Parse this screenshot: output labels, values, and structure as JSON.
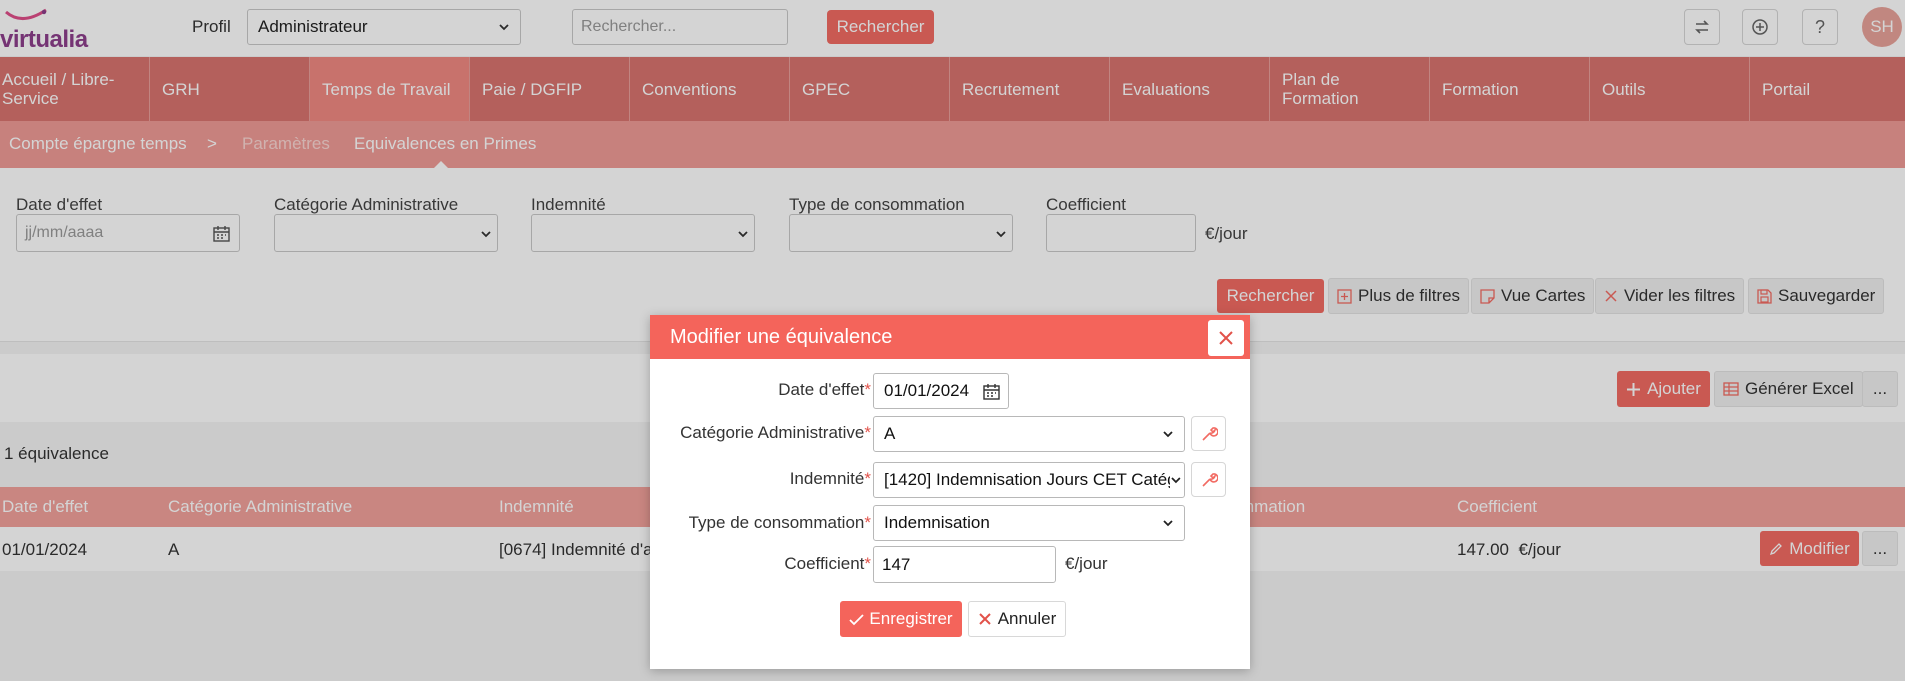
{
  "header": {
    "brand": "virtualia",
    "profil_label": "Profil",
    "profil_value": "Administrateur",
    "search_placeholder": "Rechercher...",
    "search_button": "Rechercher",
    "help_icon_glyph": "?",
    "avatar_initials": "SH",
    "icons": [
      "switch-icon",
      "plus-circle-icon",
      "help-icon"
    ]
  },
  "main_nav": [
    {
      "label": "Accueil / Libre-Service"
    },
    {
      "label": "GRH"
    },
    {
      "label": "Temps de Travail",
      "active": true
    },
    {
      "label": "Paie / DGFIP"
    },
    {
      "label": "Conventions"
    },
    {
      "label": "GPEC"
    },
    {
      "label": "Recrutement"
    },
    {
      "label": "Evaluations"
    },
    {
      "label": "Plan de Formation"
    },
    {
      "label": "Formation"
    },
    {
      "label": "Outils"
    },
    {
      "label": "Portail"
    }
  ],
  "sub_nav": {
    "item1": "Compte épargne temps",
    "separator": ">",
    "item2": "Paramètres",
    "item3": "Equivalences en Primes"
  },
  "filters": {
    "date_label": "Date d'effet",
    "date_placeholder": "jj/mm/aaaa",
    "categorie_label": "Catégorie Administrative",
    "indemnite_label": "Indemnité",
    "type_label": "Type de consommation",
    "coefficient_label": "Coefficient",
    "coefficient_unit": "€/jour",
    "buttons": {
      "rechercher": "Rechercher",
      "plus_filtres": "Plus de filtres",
      "vue_cartes": "Vue Cartes",
      "vider": "Vider les filtres",
      "sauvegarder": "Sauvegarder"
    }
  },
  "toolbar": {
    "ajouter": "Ajouter",
    "generer_excel": "Générer Excel",
    "more": "..."
  },
  "results": {
    "count": "1 équivalence",
    "columns": [
      "Date d'effet",
      "Catégorie Administrative",
      "Indemnité",
      "mmation",
      "Coefficient"
    ],
    "rows": [
      {
        "date": "01/01/2024",
        "categorie": "A",
        "indemnite": "[0674] Indemnité d'a",
        "coefficient": "147.00  €/jour",
        "modifier": "Modifier",
        "more": "..."
      }
    ]
  },
  "modal": {
    "title": "Modifier une équivalence",
    "required_mark": "*",
    "date_label": "Date d'effet",
    "date_value": "01/01/2024",
    "categorie_label": "Catégorie Administrative",
    "categorie_value": "A",
    "indemnite_label": "Indemnité",
    "indemnite_value": "[1420] Indemnisation Jours CET Catégo",
    "type_label": "Type de consommation",
    "type_value": "Indemnisation",
    "coefficient_label": "Coefficient",
    "coefficient_value": "147",
    "coefficient_unit": "€/jour",
    "save_button": "Enregistrer",
    "cancel_button": "Annuler"
  },
  "colors": {
    "nav": "#d9746f",
    "nav_active": "#f18a83",
    "subnav": "#f09c97",
    "accent": "#f4645b"
  }
}
